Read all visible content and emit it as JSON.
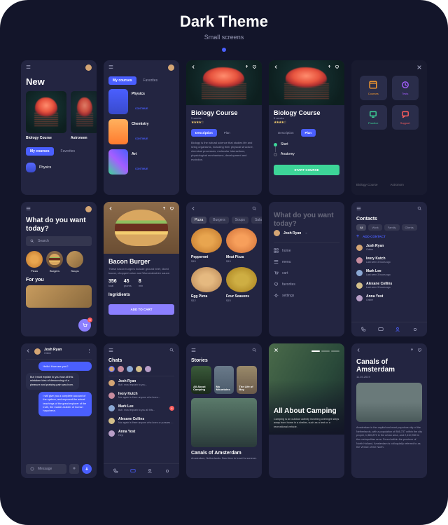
{
  "header": {
    "title": "Dark Theme",
    "subtitle": "Small screens"
  },
  "s1": {
    "title": "New",
    "card1": "Biology Course",
    "card2": "Astronom",
    "tab1": "My courses",
    "tab2": "Favorites",
    "row_label": "Physics"
  },
  "s2": {
    "tab1": "My courses",
    "tab2": "Favorites",
    "items": [
      {
        "name": "Physics",
        "cta": "CONTINUE"
      },
      {
        "name": "Chemistry",
        "cta": "CONTINUE"
      },
      {
        "name": "Art",
        "cta": "CONTINUE"
      }
    ]
  },
  "s3": {
    "title": "Biology Course",
    "meta": "5 weeks",
    "tab1": "Description",
    "tab2": "Plan",
    "body": "Biology is the natural science that studies life and living organisms, including their physical structure, chemical processes, molecular interactions, physiological mechanisms, development and evolution."
  },
  "s4": {
    "title": "Biology Course",
    "meta": "5 weeks",
    "tab1": "Description",
    "tab2": "Plan",
    "step1": "Start",
    "step2": "Anatomy",
    "cta": "START COURSE"
  },
  "s5": {
    "tiles": [
      {
        "label": "Courses",
        "color": "#ff9f2e"
      },
      {
        "label": "Tests",
        "color": "#a55eff"
      },
      {
        "label": "Practice",
        "color": "#3dd598"
      },
      {
        "label": "Support",
        "color": "#ff5e5e"
      }
    ],
    "bg_card1": "Biology Course",
    "bg_card2": "Astronom"
  },
  "s6": {
    "title": "What do you want today?",
    "search": "Search",
    "cats": [
      "Pizza",
      "Burgers",
      "Soups"
    ],
    "foryou": "For you"
  },
  "s7": {
    "title": "Bacon Burger",
    "desc": "These bacon burgers include ground beef, diced bacon, chopped onion and Worcestershire sauce.",
    "n1": "356",
    "n1l": "kcal",
    "n2": "45",
    "n2l": "grams",
    "n3": "8",
    "n3l": "min",
    "ing": "Ingridients",
    "cta": "ADD TO CART"
  },
  "s8": {
    "chips": [
      "Pizza",
      "Burgers",
      "Soups",
      "Salad"
    ],
    "p1": "Pepperoni",
    "p1p": "$15",
    "p2": "Meat Pizza",
    "p2p": "$19",
    "p3": "Egg Pizza",
    "p3p": "$12",
    "p4": "Four Seasons",
    "p4p": "$15"
  },
  "s9": {
    "title": "What do you want today?",
    "user": "Josh Ryan",
    "menu": [
      "home",
      "menu",
      "cart",
      "favorites",
      "settings"
    ]
  },
  "s10": {
    "title": "Contacts",
    "chips": [
      "All",
      "Work",
      "Family",
      "Clients"
    ],
    "add": "ADD CONTACT",
    "names": [
      "Josh Ryan",
      "Ivory Kutch",
      "Mark Lee",
      "Alexane Collins",
      "Anna Yost"
    ],
    "status_online": "Online",
    "status_seen": "Last seen 3 hours ago"
  },
  "s11": {
    "name": "Josh Ryan",
    "status": "Online",
    "m1": "Hello! How are you?",
    "m2": "But I must explain to you how all this mistaken idea of denouncing of a pleasure and praising pain was born.",
    "m3": "I will give you a complete account of the system, and expound the actual teachings of the great explorer of the truth, the master-builder of human happiness.",
    "input": "Message"
  },
  "s12": {
    "title": "Chats",
    "rows": [
      {
        "name": "Josh Ryan",
        "msg": "But I must explain to you..."
      },
      {
        "name": "Ivory Kutch",
        "msg": "Nor again is there anyone who loves..."
      },
      {
        "name": "Mark Lee",
        "msg": "But I must explain to you all this..."
      },
      {
        "name": "Alexane Collins",
        "msg": "Nor again is there anyone who loves or pursues or desires to obtain pain..."
      },
      {
        "name": "Anna Yost",
        "msg": "Hey!"
      }
    ]
  },
  "s13": {
    "stories": "Stories",
    "cards": [
      "All About Camping",
      "My Mountains",
      "The Life of Boy"
    ],
    "hero": "Canals of Amsterdam",
    "hero_sub": "Amsterdam, Netherlands. Best time to travel is summer."
  },
  "s14": {
    "title": "All About Camping",
    "body": "Camping is an outdoor activity involving overnight stays away from home in a shelter, such as a tent or a recreational vehicle."
  },
  "s15": {
    "title": "Canals of Amsterdam",
    "date": "11.03.2019",
    "body": "Amsterdam is the capital and most populous city of the Netherlands, with a population of 866,737 within the city proper, 1,380,872 in the urban area, and 2,410,960 in the metropolitan area. Found within the province of North Holland, Amsterdam is colloquially referred to as the Venice of the North."
  }
}
